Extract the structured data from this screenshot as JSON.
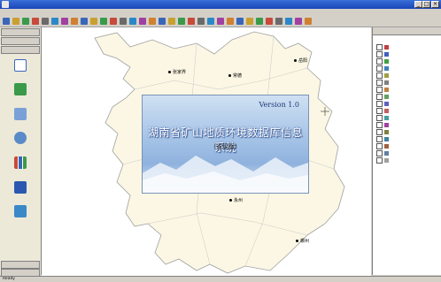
{
  "window": {
    "title": "",
    "minimize": "_",
    "maximize": "□",
    "close": "×"
  },
  "menu": [
    {
      "label": ""
    },
    {
      "label": ""
    },
    {
      "label": ""
    },
    {
      "label": ""
    },
    {
      "label": ""
    },
    {
      "label": ""
    },
    {
      "label": ""
    },
    {
      "label": ""
    },
    {
      "label": ""
    },
    {
      "label": ""
    },
    {
      "label": ""
    },
    {
      "label": ""
    },
    {
      "label": ""
    },
    {
      "label": ""
    }
  ],
  "toolbar_icons": [
    "open-icon",
    "save-icon",
    "print-icon",
    "zoom-in-icon",
    "zoom-out-icon",
    "pan-icon",
    "full-extent-icon",
    "identify-icon",
    "select-icon",
    "measure-icon",
    "layer-icon",
    "query-icon",
    "search-icon",
    "refresh-icon",
    "edit-icon",
    "draw-line-icon",
    "draw-polygon-icon",
    "delete-icon",
    "undo-icon",
    "redo-icon",
    "export-icon",
    "settings-icon",
    "help-icon",
    "info-icon",
    "grid-icon",
    "legend-icon",
    "scale-icon",
    "north-icon",
    "label-icon",
    "chart-icon",
    "table-icon",
    "report-icon"
  ],
  "left_panel": {
    "header_top": "",
    "header_second": "",
    "tools": [
      {
        "label": "",
        "color": "#3a66b8"
      },
      {
        "label": "",
        "color": "#3a9a4a"
      },
      {
        "label": "",
        "color": "#7aa0d8"
      },
      {
        "label": "",
        "color": "#5a8ac8"
      },
      {
        "label": "",
        "color": "#c84a3a"
      },
      {
        "label": "",
        "color": "#2a58b0"
      },
      {
        "label": "",
        "color": "#3a88c8"
      }
    ],
    "footer_items": [
      {
        "label": ""
      },
      {
        "label": ""
      }
    ]
  },
  "map": {
    "province_fill": "#fbf7e4",
    "province_stroke": "#a0a0a0",
    "cities": [
      {
        "name": "张家界"
      },
      {
        "name": "常德"
      },
      {
        "name": "岳阳"
      },
      {
        "name": "永州"
      },
      {
        "name": "郴州"
      }
    ]
  },
  "splash": {
    "version": "Version 1.0",
    "title": "湖南省矿山地质环境数据库信息系统",
    "subtitle": "（省级版）",
    "copyright": ""
  },
  "right_panel": {
    "header": "",
    "section_label": "",
    "layers": [
      {
        "label": "",
        "color": "#c04040"
      },
      {
        "label": "",
        "color": "#4060c0"
      },
      {
        "label": "",
        "color": "#40a040"
      },
      {
        "label": "",
        "color": "#4080c0"
      },
      {
        "label": "",
        "color": "#a0a040"
      },
      {
        "label": "",
        "color": "#808080"
      },
      {
        "label": "",
        "color": "#c08040"
      },
      {
        "label": "",
        "color": "#60a060"
      },
      {
        "label": "",
        "color": "#6060c0"
      },
      {
        "label": "",
        "color": "#c06060"
      },
      {
        "label": "",
        "color": "#40a0a0"
      },
      {
        "label": "",
        "color": "#a040a0"
      },
      {
        "label": "",
        "color": "#808040"
      },
      {
        "label": "",
        "color": "#4080a0"
      },
      {
        "label": "",
        "color": "#a06040"
      },
      {
        "label": "",
        "color": "#6080a0"
      },
      {
        "label": "",
        "color": "#a0a0a0"
      }
    ]
  },
  "status": {
    "ready": "Ready",
    "system_info": "",
    "scale": "",
    "coords": ""
  }
}
